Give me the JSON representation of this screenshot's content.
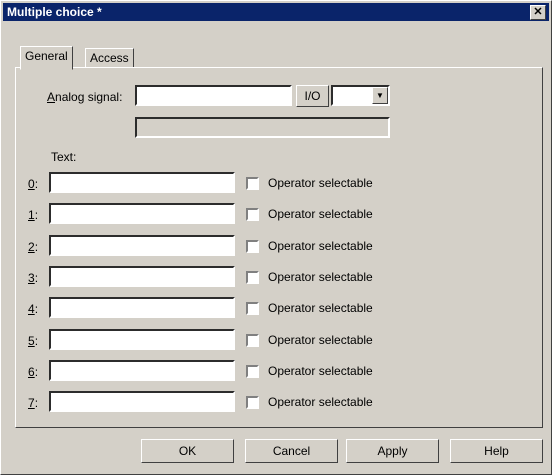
{
  "window": {
    "title": "Multiple choice *",
    "close_glyph": "✕"
  },
  "tabs": [
    {
      "label": "General"
    },
    {
      "label": "Access"
    }
  ],
  "analog": {
    "label_prefix": "A",
    "label_rest": "nalog signal:",
    "value": "",
    "io_button": "I/O",
    "dropdown_value": "",
    "secondary_value": ""
  },
  "text_header": "Text:",
  "rows": [
    {
      "index": "0",
      "suffix": ":",
      "value": "",
      "checkbox_label": "Operator selectable"
    },
    {
      "index": "1",
      "suffix": ":",
      "value": "",
      "checkbox_label": "Operator selectable"
    },
    {
      "index": "2",
      "suffix": ":",
      "value": "",
      "checkbox_label": "Operator selectable"
    },
    {
      "index": "3",
      "suffix": ":",
      "value": "",
      "checkbox_label": "Operator selectable"
    },
    {
      "index": "4",
      "suffix": ":",
      "value": "",
      "checkbox_label": "Operator selectable"
    },
    {
      "index": "5",
      "suffix": ":",
      "value": "",
      "checkbox_label": "Operator selectable"
    },
    {
      "index": "6",
      "suffix": ":",
      "value": "",
      "checkbox_label": "Operator selectable"
    },
    {
      "index": "7",
      "suffix": ":",
      "value": "",
      "checkbox_label": "Operator selectable"
    }
  ],
  "buttons": {
    "ok": "OK",
    "cancel": "Cancel",
    "apply": "Apply",
    "help": "Help"
  },
  "colors": {
    "titlebar": "#0a246a",
    "face": "#d4d0c8"
  }
}
